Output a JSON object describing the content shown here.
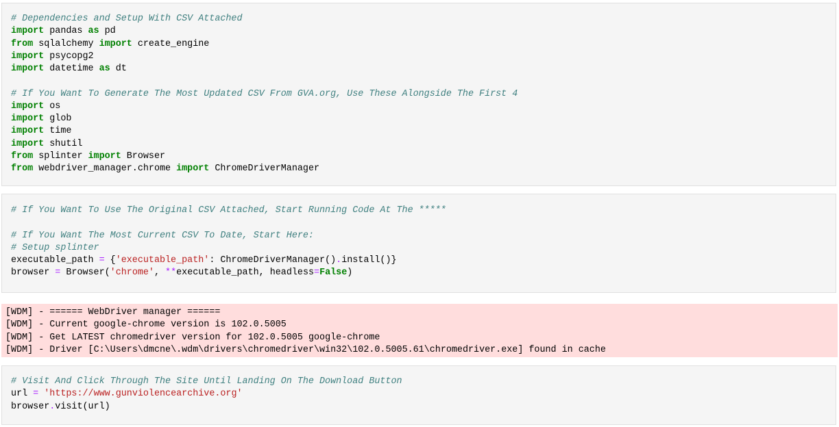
{
  "cells": [
    {
      "kind": "code",
      "lines": [
        [
          [
            "c",
            "# Dependencies and Setup With CSV Attached"
          ]
        ],
        [
          [
            "k",
            "import"
          ],
          [
            "n",
            " pandas "
          ],
          [
            "k",
            "as"
          ],
          [
            "n",
            " pd"
          ]
        ],
        [
          [
            "k",
            "from"
          ],
          [
            "n",
            " sqlalchemy "
          ],
          [
            "k",
            "import"
          ],
          [
            "n",
            " create_engine"
          ]
        ],
        [
          [
            "k",
            "import"
          ],
          [
            "n",
            " psycopg2"
          ]
        ],
        [
          [
            "k",
            "import"
          ],
          [
            "n",
            " datetime "
          ],
          [
            "k",
            "as"
          ],
          [
            "n",
            " dt"
          ]
        ],
        [],
        [
          [
            "c",
            "# If You Want To Generate The Most Updated CSV From GVA.org, Use These Alongside The First 4"
          ]
        ],
        [
          [
            "k",
            "import"
          ],
          [
            "n",
            " os"
          ]
        ],
        [
          [
            "k",
            "import"
          ],
          [
            "n",
            " glob"
          ]
        ],
        [
          [
            "k",
            "import"
          ],
          [
            "n",
            " time"
          ]
        ],
        [
          [
            "k",
            "import"
          ],
          [
            "n",
            " shutil"
          ]
        ],
        [
          [
            "k",
            "from"
          ],
          [
            "n",
            " splinter "
          ],
          [
            "k",
            "import"
          ],
          [
            "n",
            " Browser"
          ]
        ],
        [
          [
            "k",
            "from"
          ],
          [
            "n",
            " webdriver_manager.chrome "
          ],
          [
            "k",
            "import"
          ],
          [
            "n",
            " ChromeDriverManager"
          ]
        ]
      ]
    },
    {
      "kind": "code",
      "lines": [
        [
          [
            "c",
            "# If You Want To Use The Original CSV Attached, Start Running Code At The *****"
          ]
        ],
        [],
        [
          [
            "c",
            "# If You Want The Most Current CSV To Date, Start Here:"
          ]
        ],
        [
          [
            "c",
            "# Setup splinter"
          ]
        ],
        [
          [
            "n",
            "executable_path "
          ],
          [
            "o",
            "="
          ],
          [
            "n",
            " {"
          ],
          [
            "s",
            "'executable_path'"
          ],
          [
            "n",
            ": ChromeDriverManager()"
          ],
          [
            "o",
            "."
          ],
          [
            "n",
            "install()}"
          ]
        ],
        [
          [
            "n",
            "browser "
          ],
          [
            "o",
            "="
          ],
          [
            "n",
            " Browser("
          ],
          [
            "s",
            "'chrome'"
          ],
          [
            "n",
            ", "
          ],
          [
            "o",
            "**"
          ],
          [
            "n",
            "executable_path, headless"
          ],
          [
            "o",
            "="
          ],
          [
            "k",
            "False"
          ],
          [
            "n",
            ")"
          ]
        ]
      ]
    },
    {
      "kind": "stderr",
      "lines": [
        [
          [
            "n",
            "[WDM] - ====== WebDriver manager ======"
          ]
        ],
        [
          [
            "n",
            "[WDM] - Current google-chrome version is 102.0.5005"
          ]
        ],
        [
          [
            "n",
            "[WDM] - Get LATEST chromedriver version for 102.0.5005 google-chrome"
          ]
        ],
        [
          [
            "n",
            "[WDM] - Driver [C:\\Users\\dmcne\\.wdm\\drivers\\chromedriver\\win32\\102.0.5005.61\\chromedriver.exe] found in cache"
          ]
        ]
      ]
    },
    {
      "kind": "code",
      "lines": [
        [
          [
            "c",
            "# Visit And Click Through The Site Until Landing On The Download Button"
          ]
        ],
        [
          [
            "n",
            "url "
          ],
          [
            "o",
            "="
          ],
          [
            "n",
            " "
          ],
          [
            "s",
            "'https://www.gunviolencearchive.org'"
          ]
        ],
        [
          [
            "n",
            "browser"
          ],
          [
            "o",
            "."
          ],
          [
            "n",
            "visit(url)"
          ]
        ]
      ]
    }
  ]
}
